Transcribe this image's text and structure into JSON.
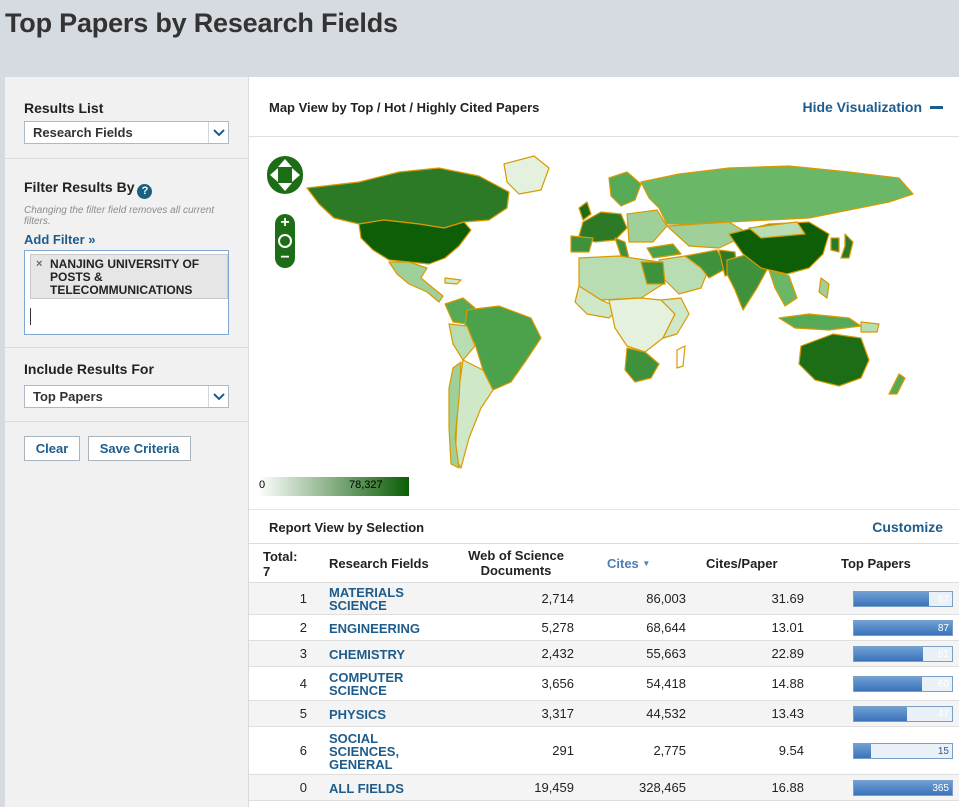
{
  "page": {
    "title": "Top Papers by Research Fields"
  },
  "sidebar": {
    "results_list_label": "Results List",
    "results_list_value": "Research Fields",
    "filter_label": "Filter Results By",
    "filter_note": "Changing the filter field removes all current filters.",
    "add_filter": "Add Filter »",
    "filter_chip": "NANJING UNIVERSITY OF POSTS & TELECOMMUNICATIONS",
    "include_label": "Include Results For",
    "include_value": "Top Papers",
    "clear_button": "Clear",
    "save_button": "Save Criteria"
  },
  "map": {
    "title": "Map View by Top / Hot / Highly Cited Papers",
    "hide_visualization": "Hide Visualization",
    "legend_min": "0",
    "legend_max": "78,327"
  },
  "report": {
    "title": "Report View by Selection",
    "customize": "Customize",
    "headers": {
      "total": "Total:\n7",
      "field": "Research Fields",
      "docs": "Web of Science Documents",
      "cites": "Cites",
      "cpp": "Cites/Paper",
      "top": "Top Papers"
    },
    "rows": [
      {
        "rank": "1",
        "field": "MATERIALS SCIENCE",
        "docs": "2,714",
        "cites": "86,003",
        "cpp": "31.69",
        "top": "67",
        "top_fraction": 0.77
      },
      {
        "rank": "2",
        "field": "ENGINEERING",
        "docs": "5,278",
        "cites": "68,644",
        "cpp": "13.01",
        "top": "87",
        "top_fraction": 1.0
      },
      {
        "rank": "3",
        "field": "CHEMISTRY",
        "docs": "2,432",
        "cites": "55,663",
        "cpp": "22.89",
        "top": "61",
        "top_fraction": 0.7
      },
      {
        "rank": "4",
        "field": "COMPUTER SCIENCE",
        "docs": "3,656",
        "cites": "54,418",
        "cpp": "14.88",
        "top": "60",
        "top_fraction": 0.69
      },
      {
        "rank": "5",
        "field": "PHYSICS",
        "docs": "3,317",
        "cites": "44,532",
        "cpp": "13.43",
        "top": "47",
        "top_fraction": 0.54
      },
      {
        "rank": "6",
        "field": "SOCIAL SCIENCES, GENERAL",
        "docs": "291",
        "cites": "2,775",
        "cpp": "9.54",
        "top": "15",
        "top_fraction": 0.17
      },
      {
        "rank": "0",
        "field": "ALL FIELDS",
        "docs": "19,459",
        "cites": "328,465",
        "cpp": "16.88",
        "top": "365",
        "top_fraction": 1.0
      }
    ]
  },
  "colors": {
    "accent": "#1e5c8c",
    "map_dark": "#0b5d05",
    "map_mid": "#56aa55",
    "map_light": "#cfe8c8",
    "border": "#d99a00"
  }
}
